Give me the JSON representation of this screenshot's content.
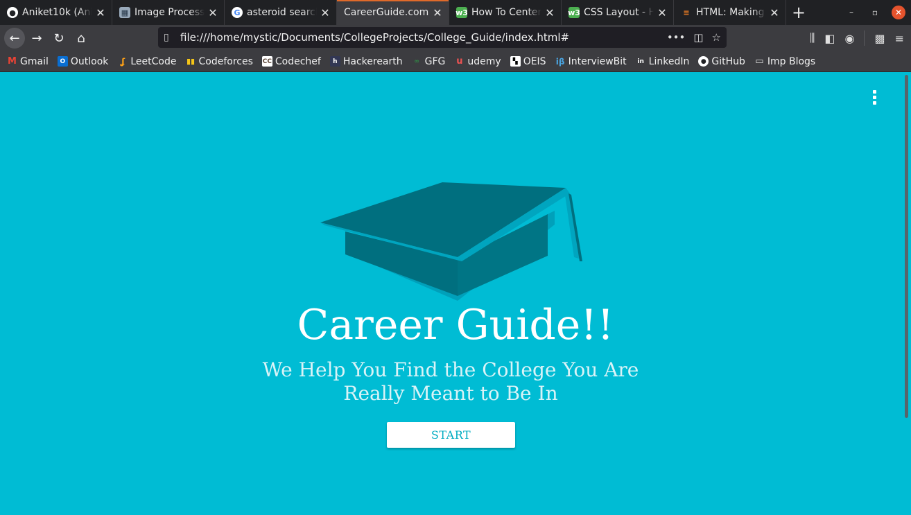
{
  "tabs": [
    {
      "title": "Aniket10k (Anik",
      "icon": "github-icon",
      "active": false
    },
    {
      "title": "Image Processi",
      "icon": "document-icon",
      "active": false
    },
    {
      "title": "asteroid search",
      "icon": "google-icon",
      "active": false
    },
    {
      "title": "CareerGuide.com",
      "icon": "",
      "active": true
    },
    {
      "title": "How To Center",
      "icon": "w3schools-icon",
      "active": false
    },
    {
      "title": "CSS Layout - Ho",
      "icon": "w3schools-icon",
      "active": false
    },
    {
      "title": "HTML: Making a",
      "icon": "stackoverflow-icon",
      "active": false
    }
  ],
  "navbar": {
    "url": "file:///home/mystic/Documents/CollegeProjects/College_Guide/index.html#"
  },
  "bookmarks": [
    {
      "label": "Gmail",
      "icon": "gmail-icon"
    },
    {
      "label": "Outlook",
      "icon": "outlook-icon"
    },
    {
      "label": "LeetCode",
      "icon": "leetcode-icon"
    },
    {
      "label": "Codeforces",
      "icon": "codeforces-icon"
    },
    {
      "label": "Codechef",
      "icon": "codechef-icon"
    },
    {
      "label": "Hackerearth",
      "icon": "hackerearth-icon"
    },
    {
      "label": "GFG",
      "icon": "gfg-icon"
    },
    {
      "label": "udemy",
      "icon": "udemy-icon"
    },
    {
      "label": "OEIS",
      "icon": "oeis-icon"
    },
    {
      "label": "InterviewBit",
      "icon": "interviewbit-icon"
    },
    {
      "label": "LinkedIn",
      "icon": "linkedin-icon"
    },
    {
      "label": "GitHub",
      "icon": "github-icon"
    },
    {
      "label": "Imp Blogs",
      "icon": "folder-icon"
    }
  ],
  "page": {
    "background_color": "#00bcd4",
    "title": "Career Guide!!",
    "subtitle": "We Help You Find the College You Are Really Meant to Be In",
    "start_label": "START"
  }
}
